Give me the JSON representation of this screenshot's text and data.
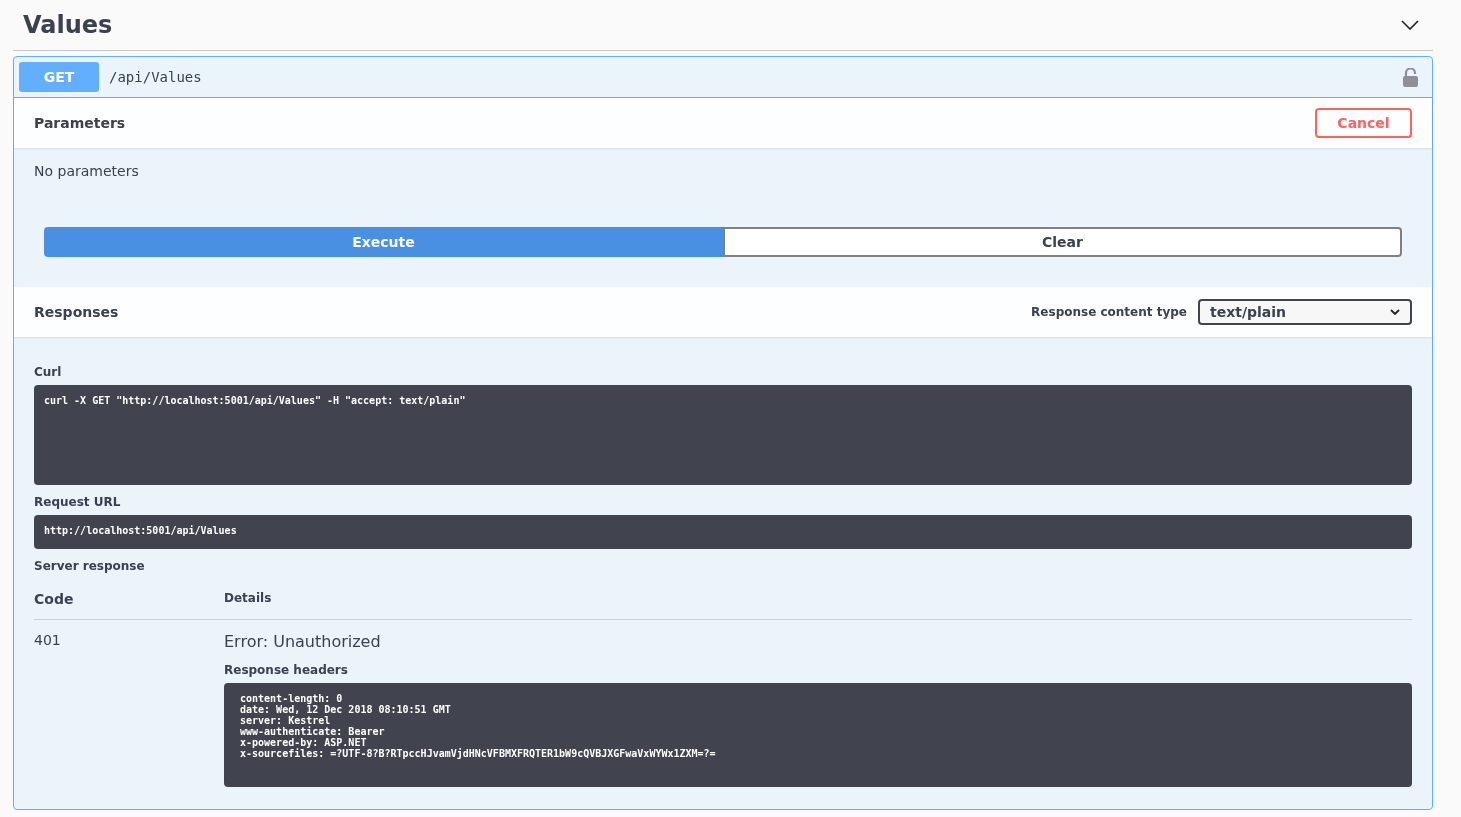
{
  "section": {
    "title": "Values",
    "expanded": true
  },
  "operation": {
    "method": "GET",
    "path": "/api/Values",
    "locked": false
  },
  "parameters": {
    "title": "Parameters",
    "cancel_label": "Cancel",
    "empty_text": "No parameters"
  },
  "actions": [
    {
      "label": "Execute",
      "kind": "primary"
    },
    {
      "label": "Clear",
      "kind": "secondary"
    }
  ],
  "responses": {
    "title": "Responses",
    "content_type_label": "Response content type",
    "content_type": "text/plain"
  },
  "curl": {
    "label": "Curl",
    "command": "curl -X GET \"http://localhost:5001/api/Values\" -H \"accept: text/plain\""
  },
  "request_url": {
    "label": "Request URL",
    "url": "http://localhost:5001/api/Values"
  },
  "server_response": {
    "label": "Server response",
    "columns": [
      "Code",
      "Details"
    ],
    "rows": [
      {
        "code": "401",
        "details": "Error: Unauthorized",
        "headers_label": "Response headers",
        "headers": [
          "content-length: 0",
          "date: Wed, 12 Dec 2018 08:10:51 GMT",
          "server: Kestrel",
          "www-authenticate: Bearer",
          "x-powered-by: ASP.NET",
          "x-sourcefiles: =?UTF-8?B?RTpccHJvamVjdHNcVFBMXFRQTER1bW9cQVBJXGFwaVxWYWx1ZXM=?="
        ]
      }
    ]
  }
}
